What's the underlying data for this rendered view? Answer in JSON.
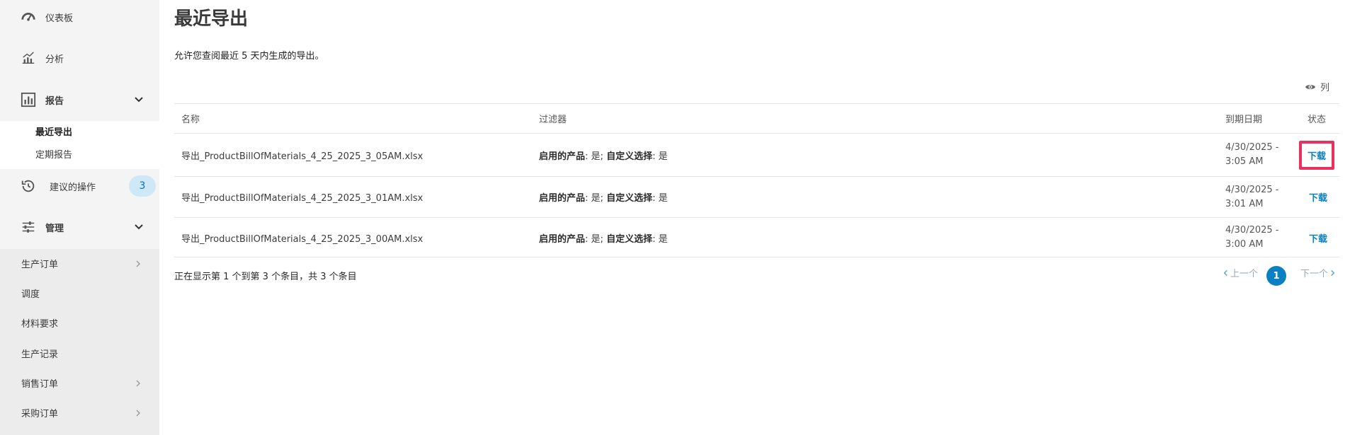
{
  "sidebar": {
    "dashboard": "仪表板",
    "analytics": "分析",
    "reports": "报告",
    "reports_sub": [
      "最近导出",
      "定期报告"
    ],
    "suggested_actions": "建议的操作",
    "suggested_count": "3",
    "admin": "管理",
    "admin_items": [
      "生产订单",
      "调度",
      "材料要求",
      "生产记录",
      "销售订单",
      "采购订单"
    ]
  },
  "page": {
    "title": "最近导出",
    "description": "允许您查阅最近 5 天内生成的导出。",
    "columns_label": "列"
  },
  "table": {
    "headers": {
      "name": "名称",
      "filter": "过滤器",
      "expiry": "到期日期",
      "status": "状态"
    },
    "rows": [
      {
        "name": "导出_ProductBillOfMaterials_4_25_2025_3_05AM.xlsx",
        "filter_k1": "启用的产品",
        "filter_v1": ": 是; ",
        "filter_k2": "自定义选择",
        "filter_v2": ": 是",
        "date_line1": "4/30/2025 -",
        "date_line2": "3:05 AM",
        "status": "下载"
      },
      {
        "name": "导出_ProductBillOfMaterials_4_25_2025_3_01AM.xlsx",
        "filter_k1": "启用的产品",
        "filter_v1": ": 是; ",
        "filter_k2": "自定义选择",
        "filter_v2": ": 是",
        "date_line1": "4/30/2025 -",
        "date_line2": "3:01 AM",
        "status": "下载"
      },
      {
        "name": "导出_ProductBillOfMaterials_4_25_2025_3_00AM.xlsx",
        "filter_k1": "启用的产品",
        "filter_v1": ": 是; ",
        "filter_k2": "自定义选择",
        "filter_v2": ": 是",
        "date_line1": "4/30/2025 -",
        "date_line2": "3:00 AM",
        "status": "下载"
      }
    ]
  },
  "footer": {
    "info": "正在显示第 1 个到第 3 个条目，共 3 个条目",
    "prev": "上一个",
    "current_page": "1",
    "next": "下一个"
  },
  "colors": {
    "accent": "#0a7fc1",
    "highlight": "#e8315f",
    "badge_bg": "#cfe8f7"
  }
}
